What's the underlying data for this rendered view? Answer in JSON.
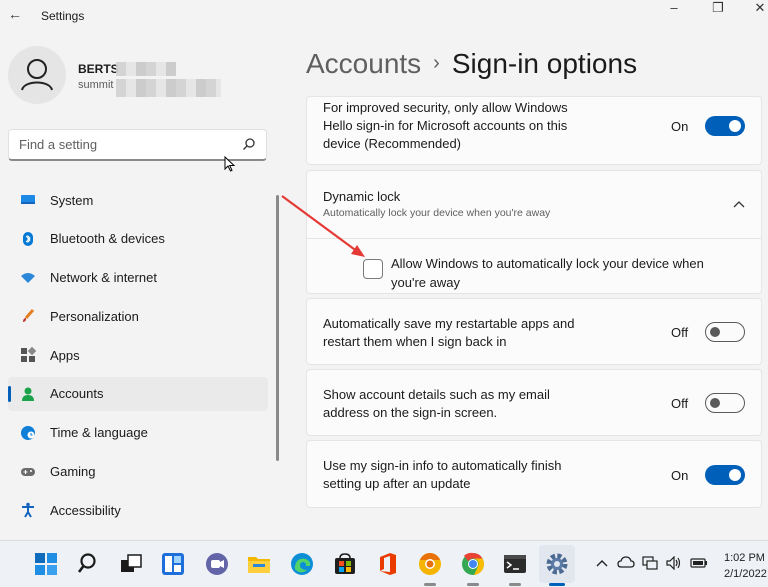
{
  "window": {
    "back_glyph": "←",
    "title": "Settings",
    "minimize_glyph": "–",
    "restore_glyph": "❐",
    "close_glyph": "✕"
  },
  "profile": {
    "name": "BERTS",
    "email": "summit"
  },
  "search": {
    "placeholder": "Find a setting",
    "value": ""
  },
  "sidebar": {
    "items": [
      {
        "label": "System",
        "icon": "monitor-icon",
        "color": "#1e88e5"
      },
      {
        "label": "Bluetooth & devices",
        "icon": "bluetooth-icon",
        "color": "#0078d4"
      },
      {
        "label": "Network & internet",
        "icon": "wifi-icon",
        "color": "#2b88d8"
      },
      {
        "label": "Personalization",
        "icon": "brush-icon",
        "color": "#e67e22"
      },
      {
        "label": "Apps",
        "icon": "apps-icon",
        "color": "#555555"
      },
      {
        "label": "Accounts",
        "icon": "person-icon",
        "color": "#1aa34a",
        "active": true
      },
      {
        "label": "Time & language",
        "icon": "globe-clock-icon",
        "color": "#0f7fd8"
      },
      {
        "label": "Gaming",
        "icon": "gamepad-icon",
        "color": "#6b6b6b"
      },
      {
        "label": "Accessibility",
        "icon": "accessibility-icon",
        "color": "#1565c0"
      }
    ]
  },
  "breadcrumb": {
    "parent": "Accounts",
    "separator": "›",
    "current": "Sign-in options"
  },
  "settings": {
    "hello_only": {
      "text": "For improved security, only allow Windows Hello sign-in for Microsoft accounts on this device (Recommended)",
      "state": "On"
    },
    "dynamic_lock": {
      "title": "Dynamic lock",
      "subtitle": "Automatically lock your device when you're away",
      "checkbox_label": "Allow Windows to automatically lock your device when you're away",
      "checked": false
    },
    "restart_apps": {
      "text": "Automatically save my restartable apps and restart them when I sign back in",
      "state": "Off"
    },
    "account_details": {
      "text": "Show account details such as my email address on the sign-in screen.",
      "state": "Off"
    },
    "signin_info": {
      "text": "Use my sign-in info to automatically finish setting up after an update",
      "state": "On"
    }
  },
  "colors": {
    "accent": "#005fb8",
    "annotation_arrow": "#e53935"
  },
  "taskbar": {
    "apps": [
      "start-icon",
      "search-icon",
      "task-view-icon",
      "widgets-icon",
      "teams-chat-icon",
      "file-explorer-icon",
      "edge-icon",
      "store-icon",
      "office-icon",
      "chrome-canary-icon",
      "chrome-icon",
      "terminal-icon",
      "settings-icon"
    ],
    "tray_chevron": "^",
    "time": "1:02 PM",
    "date": "2/1/2022"
  }
}
